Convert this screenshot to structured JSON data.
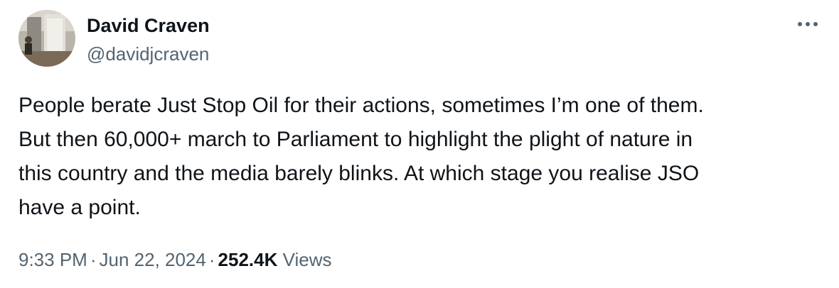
{
  "author": {
    "display_name": "David Craven",
    "handle": "@davidjcraven"
  },
  "tweet": {
    "text": "People berate Just Stop Oil for their actions, sometimes I’m one of them.\nBut then 60,000+ march to Parliament to highlight the plight of nature in\nthis country and the media barely blinks. At which stage you realise JSO\nhave a point.",
    "time": "9:33 PM",
    "separator": "·",
    "date": "Jun 22, 2024",
    "views_count": "252.4K",
    "views_label": "Views"
  },
  "icons": {
    "avatar": "profile-photo",
    "more": "more-options-icon"
  },
  "colors": {
    "text_primary": "#0f1419",
    "text_secondary": "#536471",
    "background": "#ffffff"
  }
}
